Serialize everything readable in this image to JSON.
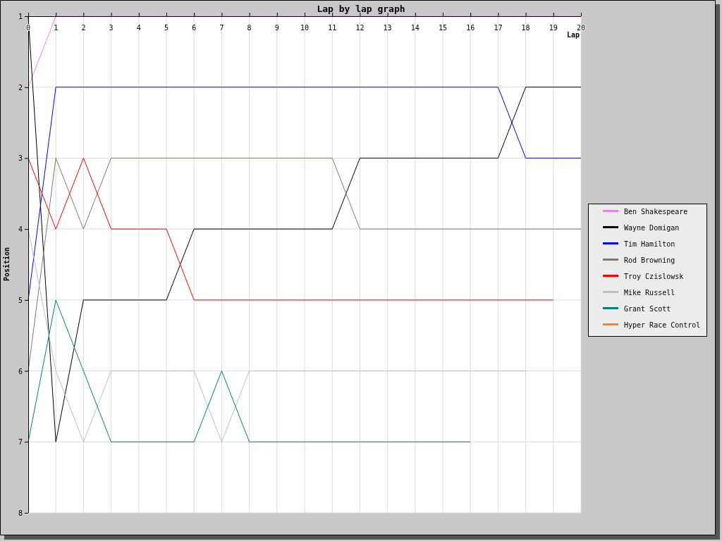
{
  "chart_data": {
    "type": "line",
    "title": "Lap by lap graph",
    "xlabel": "Lap",
    "ylabel": "Position",
    "x": [
      0,
      1,
      2,
      3,
      4,
      5,
      6,
      7,
      8,
      9,
      10,
      11,
      12,
      13,
      14,
      15,
      16,
      17,
      18,
      19,
      20
    ],
    "xticks": [
      0,
      1,
      2,
      3,
      4,
      5,
      6,
      7,
      8,
      9,
      10,
      11,
      12,
      13,
      14,
      15,
      16,
      17,
      18,
      19,
      20
    ],
    "yticks": [
      1,
      2,
      3,
      4,
      5,
      6,
      7,
      8
    ],
    "xlim": [
      0,
      20
    ],
    "ylim": [
      8,
      1
    ],
    "grid": true,
    "legend": "right",
    "series": [
      {
        "name": "Ben Shakespeare",
        "color": "#ee82ee",
        "values": [
          2,
          1,
          1,
          1,
          1,
          1,
          1,
          1,
          1,
          1,
          1,
          1,
          1,
          1,
          1,
          1,
          1,
          1,
          1,
          1,
          1
        ]
      },
      {
        "name": "Wayne Domigan",
        "color": "#000000",
        "values": [
          1,
          7,
          5,
          5,
          5,
          5,
          4,
          4,
          4,
          4,
          4,
          4,
          3,
          3,
          3,
          3,
          3,
          3,
          2,
          2,
          2
        ]
      },
      {
        "name": "Tim Hamilton",
        "color": "#0000ff",
        "values": [
          5,
          2,
          2,
          2,
          2,
          2,
          2,
          2,
          2,
          2,
          2,
          2,
          2,
          2,
          2,
          2,
          2,
          2,
          3,
          3,
          3
        ]
      },
      {
        "name": "Rod Browning",
        "color": "#8b7765",
        "values": [
          6,
          3,
          4,
          3,
          3,
          3,
          3,
          3,
          3,
          3,
          3,
          3,
          4,
          4,
          4,
          4,
          4,
          4,
          4,
          4,
          4
        ]
      },
      {
        "name": "Troy Czislowsk",
        "color": "#ff0000",
        "values": [
          3,
          4,
          3,
          4,
          4,
          4,
          5,
          5,
          5,
          5,
          5,
          5,
          5,
          5,
          5,
          5,
          5,
          5,
          5,
          5,
          null
        ]
      },
      {
        "name": "Mike Russell",
        "color": "#bebebe",
        "values": [
          4,
          6,
          7,
          6,
          6,
          6,
          6,
          7,
          6,
          6,
          6,
          6,
          6,
          6,
          6,
          6,
          6,
          6,
          6,
          null,
          null
        ]
      },
      {
        "name": "Grant Scott",
        "color": "#008080",
        "values": [
          7,
          5,
          6,
          7,
          7,
          7,
          7,
          6,
          7,
          7,
          7,
          7,
          7,
          7,
          7,
          7,
          7,
          null,
          null,
          null,
          null
        ]
      },
      {
        "name": "Hyper Race Control",
        "color": "#ff7f24",
        "values": [
          null,
          null,
          null,
          null,
          null,
          null,
          null,
          null,
          null,
          null,
          null,
          null,
          null,
          null,
          null,
          null,
          null,
          null,
          null,
          null,
          null
        ]
      }
    ]
  }
}
